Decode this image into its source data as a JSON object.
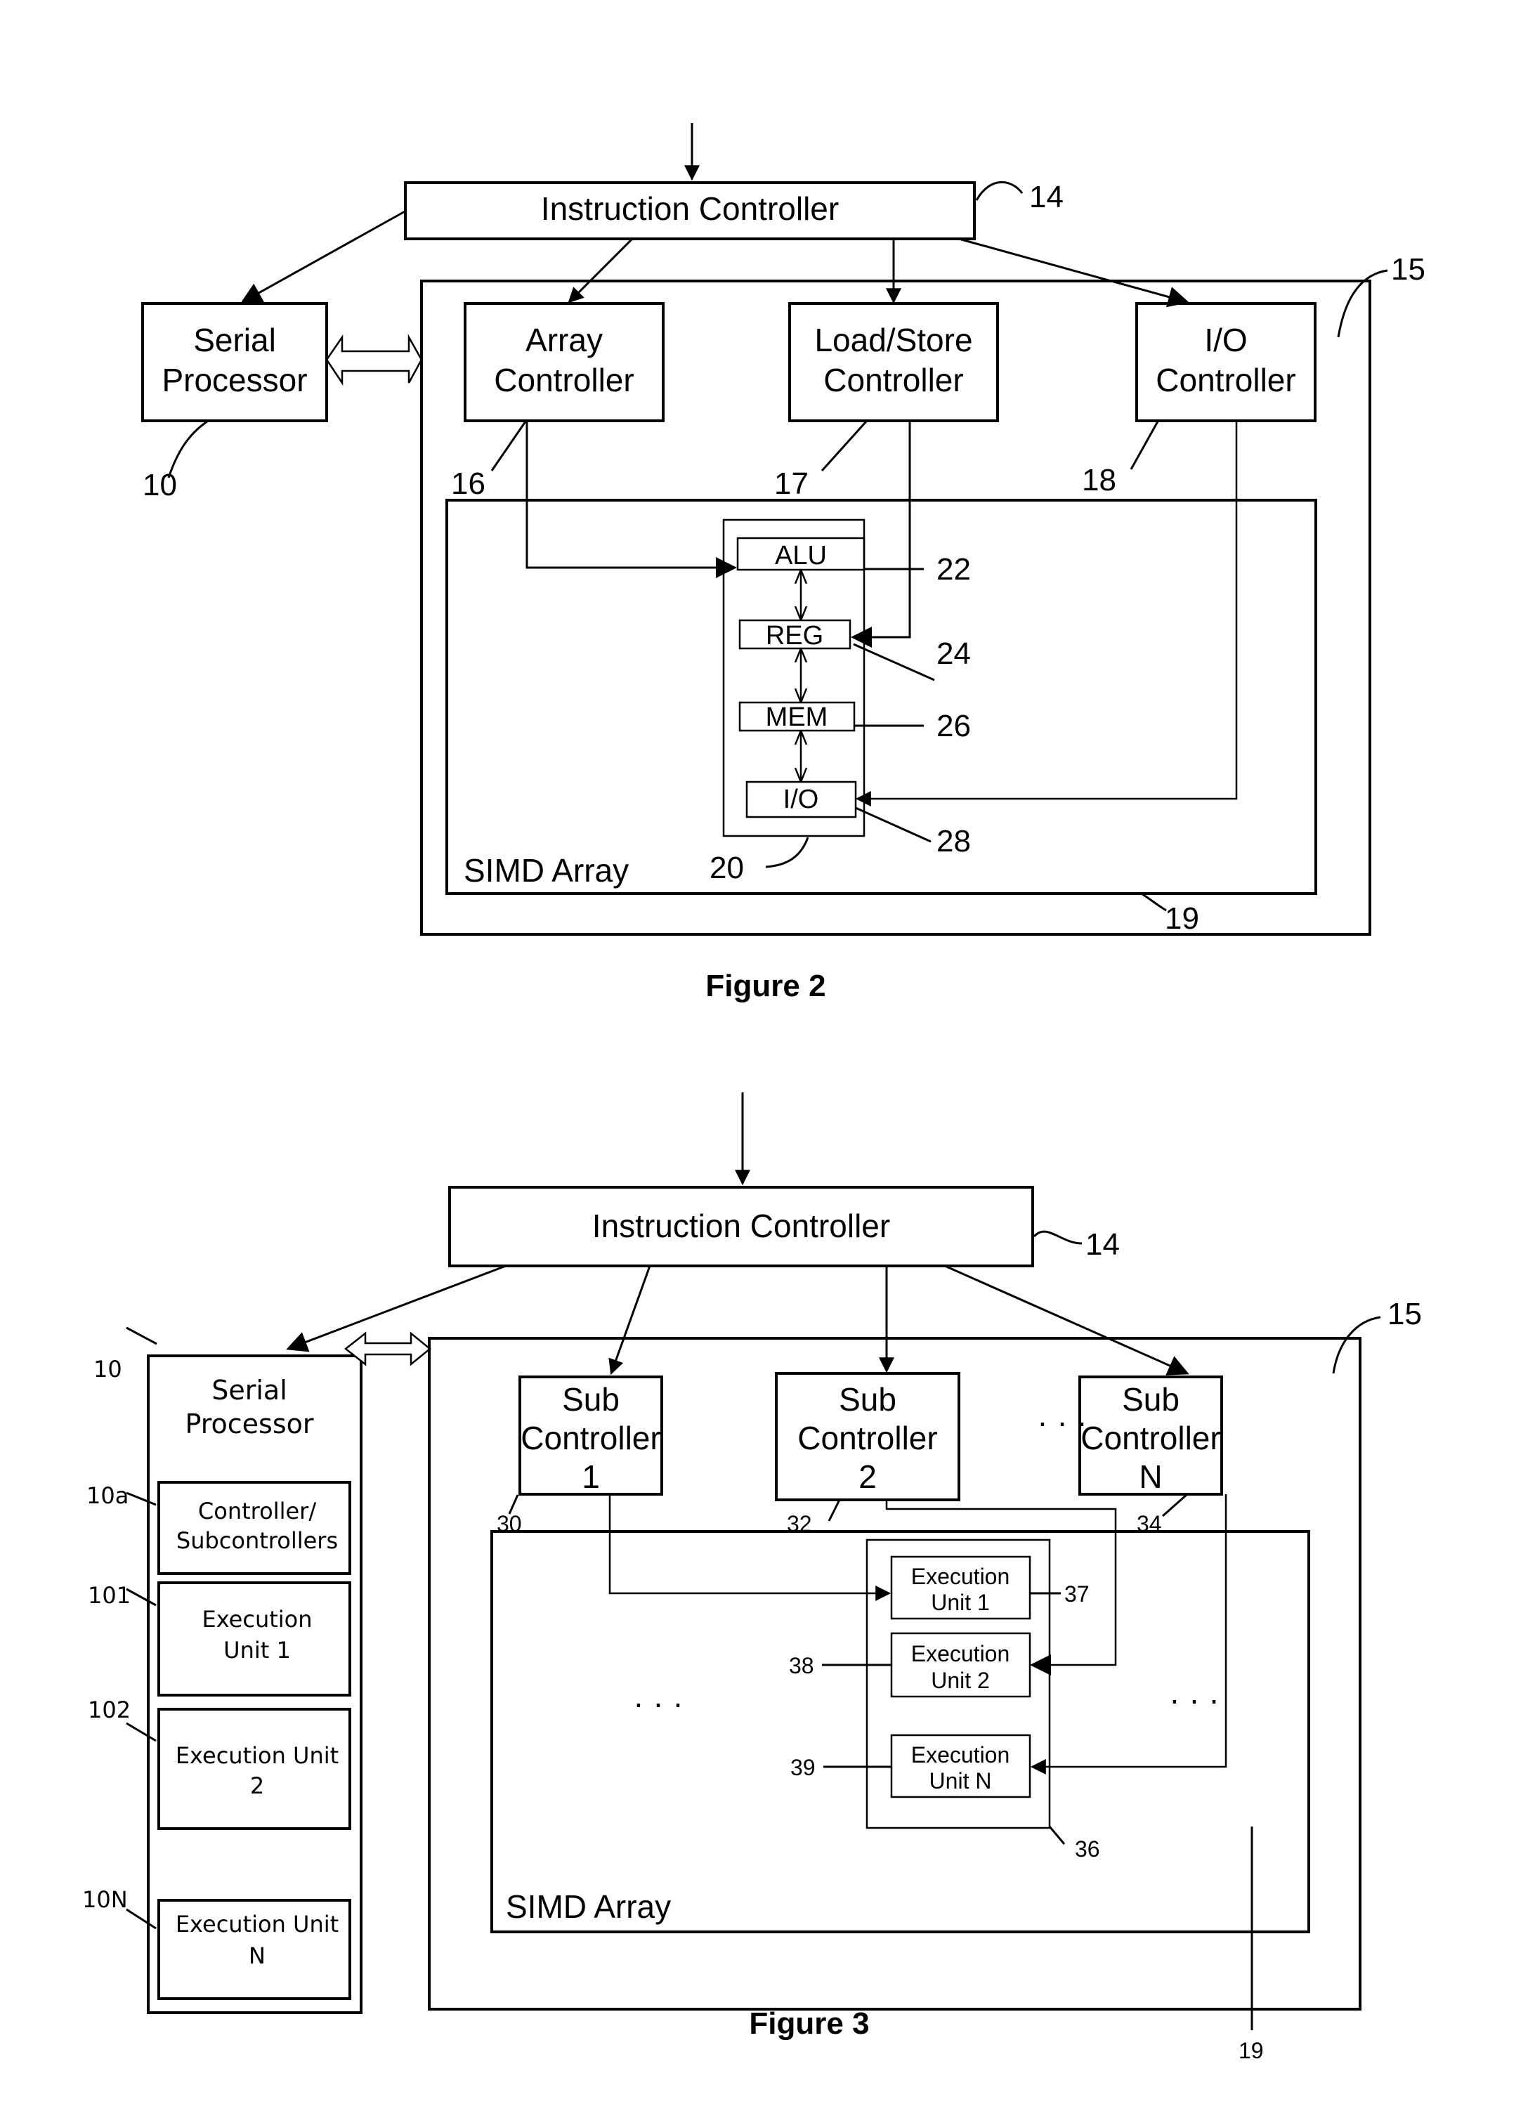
{
  "figure2": {
    "caption": "Figure 2",
    "instruction_controller": "Instruction Controller",
    "serial_processor": [
      "Serial",
      "Processor"
    ],
    "array_controller": [
      "Array",
      "Controller"
    ],
    "load_store_controller": [
      "Load/Store",
      "Controller"
    ],
    "io_controller": [
      "I/O",
      "Controller"
    ],
    "simd_array": "SIMD Array",
    "pe_units": [
      "ALU",
      "REG",
      "MEM",
      "I/O"
    ],
    "refs": {
      "serial_processor": "10",
      "instruction_controller": "14",
      "outer_block": "15",
      "array_controller": "16",
      "load_store_controller": "17",
      "io_controller": "18",
      "simd_array": "19",
      "processing_element": "20",
      "alu": "22",
      "reg": "24",
      "mem": "26",
      "io": "28"
    }
  },
  "figure3": {
    "caption": "Figure 3",
    "instruction_controller": "Instruction Controller",
    "serial_processor": [
      "Serial",
      "Processor"
    ],
    "serial_units": [
      [
        "Controller/",
        "Subcontrollers"
      ],
      [
        "Execution",
        "Unit 1"
      ],
      [
        "Execution Unit",
        "2"
      ],
      [
        "Execution Unit",
        "N"
      ]
    ],
    "sub_controllers": [
      [
        "Sub",
        "Controller",
        "1"
      ],
      [
        "Sub",
        "Controller",
        "2"
      ],
      [
        "Sub",
        "Controller",
        "N"
      ]
    ],
    "ellipsis": "· · ·",
    "simd_array": "SIMD Array",
    "execution_units": [
      [
        "Execution",
        "Unit 1"
      ],
      [
        "Execution",
        "Unit 2"
      ],
      [
        "Execution",
        "Unit N"
      ]
    ],
    "refs": {
      "serial_processor": "10",
      "controller_subcontrollers": "10a",
      "execution_unit_1": "101",
      "execution_unit_2": "102",
      "execution_unit_n": "10N",
      "instruction_controller": "14",
      "outer_block": "15",
      "simd_array": "19",
      "sub_controller_1": "30",
      "sub_controller_2": "32",
      "sub_controller_n": "34",
      "processing_element": "36",
      "pe_unit_1": "37",
      "pe_unit_2": "38",
      "pe_unit_n": "39"
    }
  }
}
